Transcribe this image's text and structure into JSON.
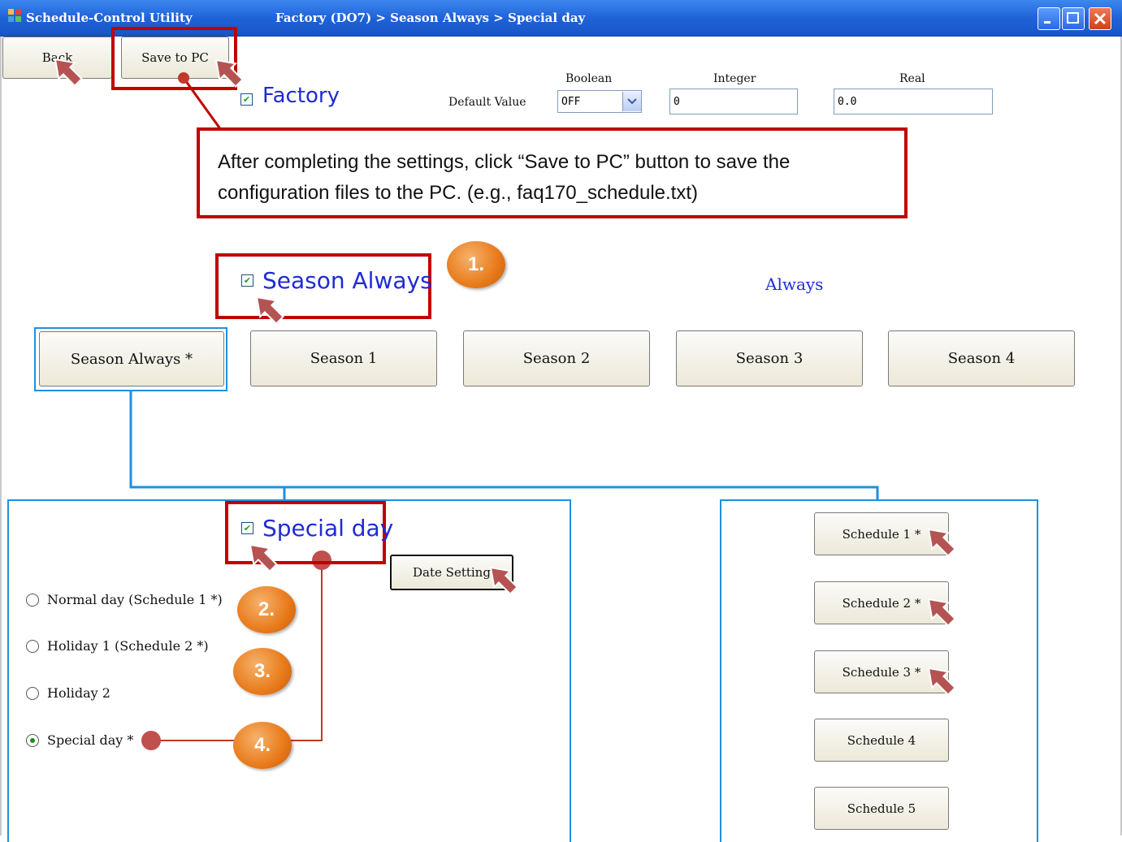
{
  "window": {
    "app_title": "Schedule-Control Utility",
    "breadcrumb": "Factory (DO7) > Season Always > Special day"
  },
  "toolbar": {
    "back_label": "Back",
    "save_label": "Save to PC"
  },
  "factory": {
    "label": "Factory",
    "checked": true
  },
  "defaults": {
    "label": "Default Value",
    "boolean_header": "Boolean",
    "boolean_value": "OFF",
    "integer_header": "Integer",
    "integer_value": "0",
    "real_header": "Real",
    "real_value": "0.0"
  },
  "annotation": {
    "text": "After completing the settings, click “Save to PC” button to save the configuration files to the PC. (e.g., faq170_schedule.txt)"
  },
  "season": {
    "label": "Season Always",
    "checked": true,
    "mode": "Always"
  },
  "season_tabs": [
    "Season Always *",
    "Season 1",
    "Season 2",
    "Season 3",
    "Season 4"
  ],
  "day": {
    "label": "Special day",
    "checked": true,
    "date_setting_label": "Date Setting",
    "options": [
      {
        "label": "Normal day (Schedule 1 *)",
        "selected": false
      },
      {
        "label": "Holiday 1 (Schedule 2 *)",
        "selected": false
      },
      {
        "label": "Holiday 2",
        "selected": false
      },
      {
        "label": "Special day *",
        "selected": true
      }
    ]
  },
  "schedules": [
    "Schedule 1 *",
    "Schedule 2 *",
    "Schedule 3 *",
    "Schedule 4",
    "Schedule 5"
  ],
  "steps": [
    "1.",
    "2.",
    "3.",
    "4."
  ],
  "colors": {
    "titlebar": "#1f63d8",
    "highlight_red": "#c00000",
    "connector_blue": "#1f8fe0",
    "badge_orange": "#e87a1a",
    "label_blue": "#1f2bd6"
  }
}
